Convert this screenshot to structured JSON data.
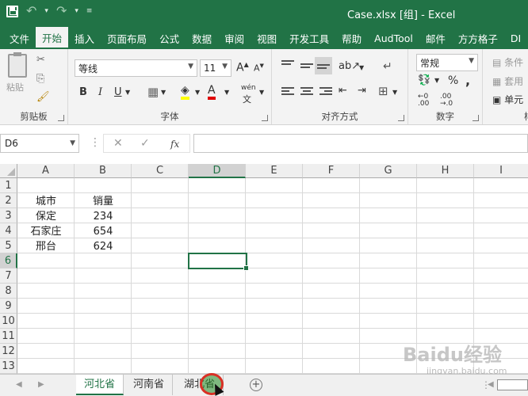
{
  "window": {
    "title": "Case.xlsx  [组]  -  Excel",
    "undo_icon": "undo-icon",
    "redo_icon": "redo-icon",
    "save_icon": "save-icon"
  },
  "ribbon_tabs": [
    "文件",
    "开始",
    "插入",
    "页面布局",
    "公式",
    "数据",
    "审阅",
    "视图",
    "开发工具",
    "帮助",
    "AudTool",
    "邮件",
    "方方格子",
    "DI"
  ],
  "active_tab": "开始",
  "ribbon": {
    "clipboard": {
      "paste_label": "粘贴",
      "group_label": "剪贴板"
    },
    "font": {
      "font_name": "等线",
      "font_size": "11",
      "bold": "B",
      "italic": "I",
      "underline": "U",
      "wen": "wén",
      "group_label": "字体"
    },
    "alignment": {
      "group_label": "对齐方式"
    },
    "number": {
      "format": "常规",
      "percent": "%",
      "comma": ",",
      "group_label": "数字"
    },
    "styles": {
      "item1": "条件",
      "item2": "套用",
      "item3": "单元",
      "group_label": "样"
    }
  },
  "formula_bar": {
    "name_box": "D6",
    "cancel": "✕",
    "enter": "✓",
    "fx": "fx",
    "content": ""
  },
  "columns": [
    "A",
    "B",
    "C",
    "D",
    "E",
    "F",
    "G",
    "H",
    "I"
  ],
  "selected_column": "D",
  "rows": [
    "1",
    "2",
    "3",
    "4",
    "5",
    "6",
    "7",
    "8",
    "9",
    "10",
    "11",
    "12",
    "13"
  ],
  "selected_row": "6",
  "cells": {
    "A2": "城市",
    "B2": "销量",
    "A3": "保定",
    "B3": "234",
    "A4": "石家庄",
    "B4": "654",
    "A5": "邢台",
    "B5": "624"
  },
  "sheets": [
    "河北省",
    "河南省",
    "湖北省"
  ],
  "active_sheet": "河北省",
  "watermark": {
    "text": "Baidu经验",
    "sub": "jingyan.baidu.com"
  }
}
